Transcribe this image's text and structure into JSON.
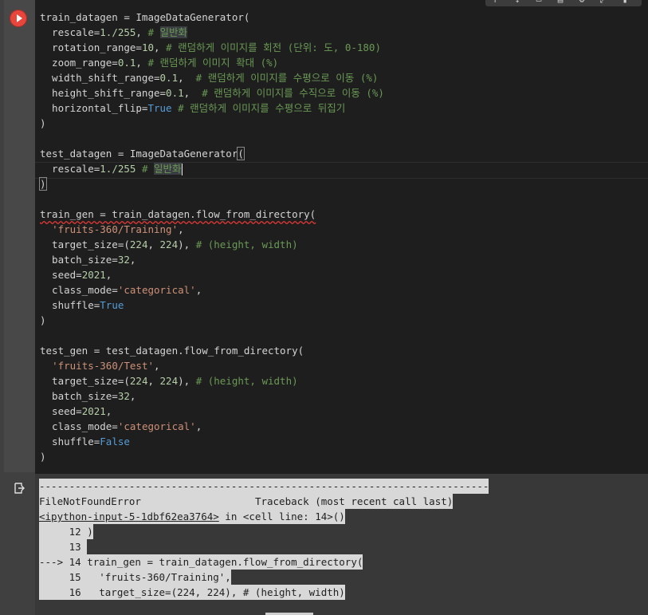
{
  "code_lines": [
    [
      {
        "t": "train_datagen = ImageDataGenerator(",
        "c": ""
      }
    ],
    [
      {
        "t": "  rescale=",
        "c": ""
      },
      {
        "t": "1./255",
        "c": "num"
      },
      {
        "t": ", ",
        "c": ""
      },
      {
        "t": "# ",
        "c": "cm"
      },
      {
        "t": "일반화",
        "c": "cm hl"
      }
    ],
    [
      {
        "t": "  rotation_range=",
        "c": ""
      },
      {
        "t": "10",
        "c": "num"
      },
      {
        "t": ", ",
        "c": ""
      },
      {
        "t": "# 랜덤하게 이미지를 회전 (단위: 도, 0-180)",
        "c": "cm"
      }
    ],
    [
      {
        "t": "  zoom_range=",
        "c": ""
      },
      {
        "t": "0.1",
        "c": "num"
      },
      {
        "t": ", ",
        "c": ""
      },
      {
        "t": "# 랜덤하게 이미지 확대 (%)",
        "c": "cm"
      }
    ],
    [
      {
        "t": "  width_shift_range=",
        "c": ""
      },
      {
        "t": "0.1",
        "c": "num"
      },
      {
        "t": ",  ",
        "c": ""
      },
      {
        "t": "# 랜덤하게 이미지를 수평으로 이동 (%)",
        "c": "cm"
      }
    ],
    [
      {
        "t": "  height_shift_range=",
        "c": ""
      },
      {
        "t": "0.1",
        "c": "num"
      },
      {
        "t": ",  ",
        "c": ""
      },
      {
        "t": "# 랜덤하게 이미지를 수직으로 이동 (%)",
        "c": "cm"
      }
    ],
    [
      {
        "t": "  horizontal_flip=",
        "c": ""
      },
      {
        "t": "True",
        "c": "kw"
      },
      {
        "t": " ",
        "c": ""
      },
      {
        "t": "# 랜덤하게 이미지를 수평으로 뒤집기",
        "c": "cm"
      }
    ],
    [
      {
        "t": ")",
        "c": ""
      }
    ],
    [
      {
        "t": "",
        "c": ""
      }
    ],
    [
      {
        "t": "test_datagen = ImageDataGenerator",
        "c": ""
      },
      {
        "t": "(",
        "c": "bracket-match"
      }
    ],
    [
      {
        "t": "  rescale=",
        "c": ""
      },
      {
        "t": "1./255",
        "c": "num"
      },
      {
        "t": " ",
        "c": ""
      },
      {
        "t": "# ",
        "c": "cm"
      },
      {
        "t": "일반화",
        "c": "cm hl"
      },
      {
        "t": "",
        "c": "cursor"
      }
    ],
    [
      {
        "t": ")",
        "c": "bracket-match"
      }
    ],
    [
      {
        "t": "",
        "c": ""
      }
    ],
    [
      {
        "t": "train_gen = train_datagen.flow_from_directory(",
        "c": "err"
      }
    ],
    [
      {
        "t": "  ",
        "c": ""
      },
      {
        "t": "'fruits-360/Training'",
        "c": "str"
      },
      {
        "t": ",",
        "c": ""
      }
    ],
    [
      {
        "t": "  target_size=(",
        "c": ""
      },
      {
        "t": "224",
        "c": "num"
      },
      {
        "t": ", ",
        "c": ""
      },
      {
        "t": "224",
        "c": "num"
      },
      {
        "t": "), ",
        "c": ""
      },
      {
        "t": "# (height, width)",
        "c": "cm"
      }
    ],
    [
      {
        "t": "  batch_size=",
        "c": ""
      },
      {
        "t": "32",
        "c": "num"
      },
      {
        "t": ",",
        "c": ""
      }
    ],
    [
      {
        "t": "  seed=",
        "c": ""
      },
      {
        "t": "2021",
        "c": "num"
      },
      {
        "t": ",",
        "c": ""
      }
    ],
    [
      {
        "t": "  class_mode=",
        "c": ""
      },
      {
        "t": "'categorical'",
        "c": "str"
      },
      {
        "t": ",",
        "c": ""
      }
    ],
    [
      {
        "t": "  shuffle=",
        "c": ""
      },
      {
        "t": "True",
        "c": "kw"
      }
    ],
    [
      {
        "t": ")",
        "c": ""
      }
    ],
    [
      {
        "t": "",
        "c": ""
      }
    ],
    [
      {
        "t": "test_gen = test_datagen.flow_from_directory(",
        "c": ""
      }
    ],
    [
      {
        "t": "  ",
        "c": ""
      },
      {
        "t": "'fruits-360/Test'",
        "c": "str"
      },
      {
        "t": ",",
        "c": ""
      }
    ],
    [
      {
        "t": "  target_size=(",
        "c": ""
      },
      {
        "t": "224",
        "c": "num"
      },
      {
        "t": ", ",
        "c": ""
      },
      {
        "t": "224",
        "c": "num"
      },
      {
        "t": "), ",
        "c": ""
      },
      {
        "t": "# (height, width)",
        "c": "cm"
      }
    ],
    [
      {
        "t": "  batch_size=",
        "c": ""
      },
      {
        "t": "32",
        "c": "num"
      },
      {
        "t": ",",
        "c": ""
      }
    ],
    [
      {
        "t": "  seed=",
        "c": ""
      },
      {
        "t": "2021",
        "c": "num"
      },
      {
        "t": ",",
        "c": ""
      }
    ],
    [
      {
        "t": "  class_mode=",
        "c": ""
      },
      {
        "t": "'categorical'",
        "c": "str"
      },
      {
        "t": ",",
        "c": ""
      }
    ],
    [
      {
        "t": "  shuffle=",
        "c": ""
      },
      {
        "t": "False",
        "c": "kw"
      }
    ],
    [
      {
        "t": ")",
        "c": ""
      }
    ]
  ],
  "output": {
    "divider": "---------------------------------------------------------------------------",
    "error_name": "FileNotFoundError",
    "traceback_label": "Traceback (most recent call last)",
    "source_link": "<ipython-input-5-1dbf62ea3764>",
    "source_suffix": " in <cell line: 14>()",
    "trace_lines": [
      "     12 )",
      "     13 ",
      "---> 14 train_gen = train_datagen.flow_from_directory(",
      "     15   'fruits-360/Training',",
      "     16   target_size=(224, 224), # (height, width)"
    ]
  },
  "toolbar_icons": [
    "move-up-icon",
    "move-down-icon",
    "link-icon",
    "comment-icon",
    "gear-icon",
    "expand-icon",
    "delete-icon"
  ],
  "colors": {
    "editor_bg": "#1e1e1e",
    "run_button": "#e8453c",
    "output_bg": "#d8d8d8"
  }
}
